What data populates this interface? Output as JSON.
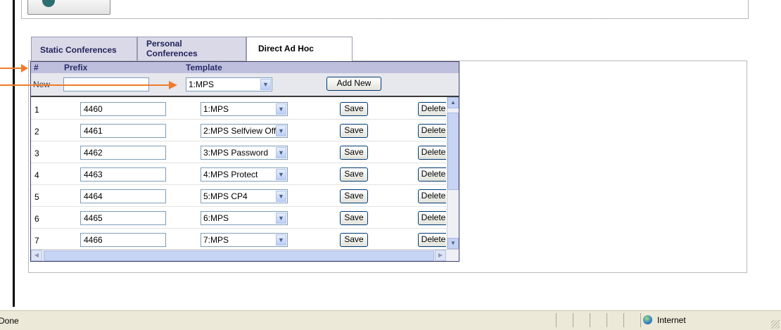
{
  "tabs": [
    {
      "label": "Static Conferences",
      "active": false
    },
    {
      "label_line1": "Personal",
      "label_line2": "Conferences",
      "active": false
    },
    {
      "label": "Direct Ad Hoc",
      "active": true
    }
  ],
  "grid": {
    "headers": {
      "num": "#",
      "prefix": "Prefix",
      "template": "Template"
    },
    "new_row": {
      "label": "New",
      "prefix_value": "",
      "template_value": "1:MPS",
      "add_button": "Add New"
    },
    "rows": [
      {
        "num": "1",
        "prefix": "4460",
        "template": "1:MPS",
        "save": "Save",
        "delete": "Delete"
      },
      {
        "num": "2",
        "prefix": "4461",
        "template": "2:MPS Selfview Off",
        "save": "Save",
        "delete": "Delete"
      },
      {
        "num": "3",
        "prefix": "4462",
        "template": "3:MPS Password",
        "save": "Save",
        "delete": "Delete"
      },
      {
        "num": "4",
        "prefix": "4463",
        "template": "4:MPS Protect",
        "save": "Save",
        "delete": "Delete"
      },
      {
        "num": "5",
        "prefix": "4464",
        "template": "5:MPS CP4",
        "save": "Save",
        "delete": "Delete"
      },
      {
        "num": "6",
        "prefix": "4465",
        "template": "6:MPS",
        "save": "Save",
        "delete": "Delete"
      },
      {
        "num": "7",
        "prefix": "4466",
        "template": "7:MPS",
        "save": "Save",
        "delete": "Delete"
      }
    ]
  },
  "status_bar": {
    "text": "Done",
    "zone": "Internet"
  },
  "colors": {
    "arrow": "#f07c2a",
    "header_bg": "#bdbfdc",
    "tab_bg": "#d9d9e8"
  },
  "icons": {
    "dropdown": "chevron-down-icon",
    "zone": "globe-icon",
    "annotation": "arrow-icon"
  }
}
